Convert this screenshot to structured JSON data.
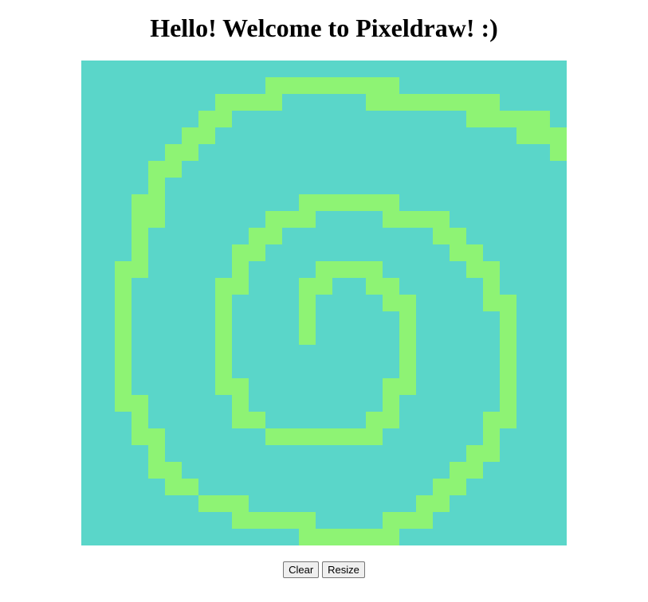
{
  "header": {
    "title": "Hello! Welcome to Pixeldraw! :)"
  },
  "canvas": {
    "columns": 29,
    "rows": 29,
    "background_color": "#5ad6c9",
    "paint_color": "#8ef374",
    "painted_rows": [
      "                             ",
      "     ...........             ",
      "   ....     ..........      ",
      "   ...         ....  ....   ",
      "  ...          ..........   ",
      "  ...             .....     ",
      "  ...                       ",
      "  ...                       ",
      "  .                         ",
      "  .                         ",
      " ..                         ",
      "                             ",
      " .                          ",
      " .                          ",
      " .                          ",
      " ..                         ",
      "  .                         ",
      "  .                         ",
      "  ..                        ",
      "   .                        ",
      "   ..                       ",
      "    ..                      ",
      "     ...                    ",
      "       ....                 ",
      "           ......           ",
      "                             ",
      "                             ",
      "                             ",
      "                             "
    ]
  },
  "controls": {
    "clear_label": "Clear",
    "resize_label": "Resize"
  }
}
